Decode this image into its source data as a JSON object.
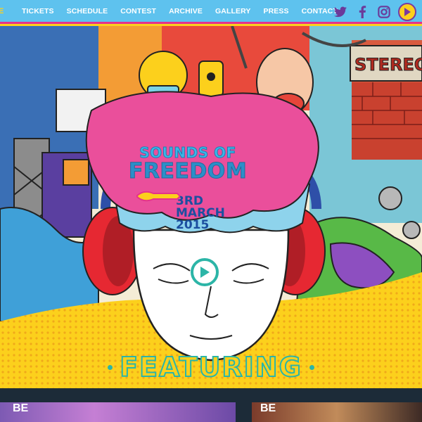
{
  "nav": {
    "partial_item": "E",
    "items": [
      "TICKETS",
      "SCHEDULE",
      "CONTEST",
      "ARCHIVE",
      "GALLERY",
      "PRESS",
      "CONTACT"
    ],
    "social": [
      "twitter-icon",
      "facebook-icon",
      "instagram-icon",
      "play-icon"
    ]
  },
  "hero": {
    "logo_line1": "SOUNDS OF",
    "logo_line2": "FREEDOM",
    "date_line1": "3RD MARCH",
    "date_line2": "2015",
    "wall_sign": "STEREOT"
  },
  "featuring": {
    "title": "FEATURING"
  },
  "cards": [
    {
      "label": "BE"
    },
    {
      "label": "BE"
    }
  ],
  "colors": {
    "nav_bg": "#5ec2ee",
    "accent_pink": "#e4338b",
    "yellow": "#fcd01c",
    "teal": "#2cb5a7",
    "dark_strip": "#1c2b38"
  }
}
